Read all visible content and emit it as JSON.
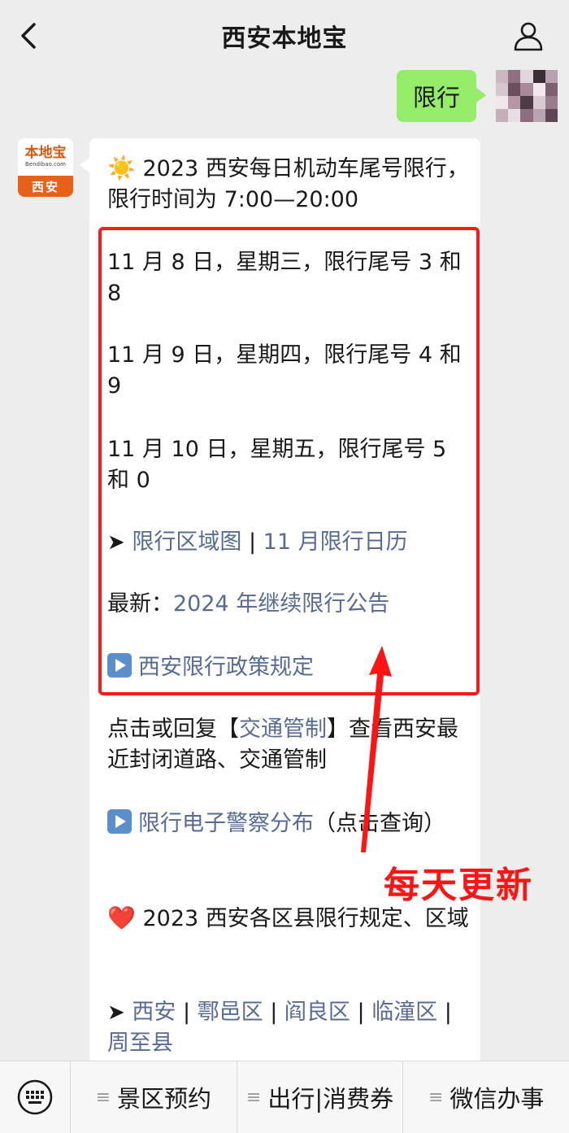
{
  "header": {
    "title": "西安本地宝"
  },
  "user_message": {
    "text": "限行"
  },
  "bot_avatar": {
    "logo_text": "本地宝",
    "logo_sub": "Bendibao.com",
    "city": "西安"
  },
  "bot_message": {
    "intro": {
      "emoji": "☀️",
      "text": "2023 西安每日机动车尾号限行，限行时间为 7:00—20:00"
    },
    "days": [
      {
        "text": "11 月 8 日，星期三，限行尾号 3 和 8"
      },
      {
        "text": "11 月 9 日，星期四，限行尾号 4 和 9"
      },
      {
        "text": "11 月 10 日，星期五，限行尾号 5 和 0"
      }
    ],
    "links_row": {
      "marker": "➤",
      "link1": "限行区域图",
      "sep": " | ",
      "link2": "11 月限行日历"
    },
    "latest": {
      "prefix": "最新：",
      "link": "2024 年继续限行公告"
    },
    "policy": {
      "link": "西安限行政策规定"
    },
    "traffic": {
      "pre": "点击或回复【",
      "link": "交通管制",
      "post": "】查看西安最近封闭道路、交通管制"
    },
    "camera": {
      "link": "限行电子警察分布",
      "post": "（点击查询）"
    },
    "districts_intro": {
      "emoji": "❤️",
      "text": "2023 西安各区县限行规定、区域"
    },
    "districts": {
      "marker": "➤",
      "items": [
        "西安",
        "鄠邑区",
        "阎良区",
        "临潼区",
        "周至县"
      ],
      "sep": " | "
    }
  },
  "annotation": {
    "text": "每天更新",
    "color": "#ff1414"
  },
  "bottom_menu": {
    "items": [
      "景区预约",
      "出行|消费券",
      "微信办事"
    ]
  },
  "colors": {
    "bubble_green": "#95ec69",
    "link": "#576b95",
    "brand_orange": "#e8611a"
  }
}
